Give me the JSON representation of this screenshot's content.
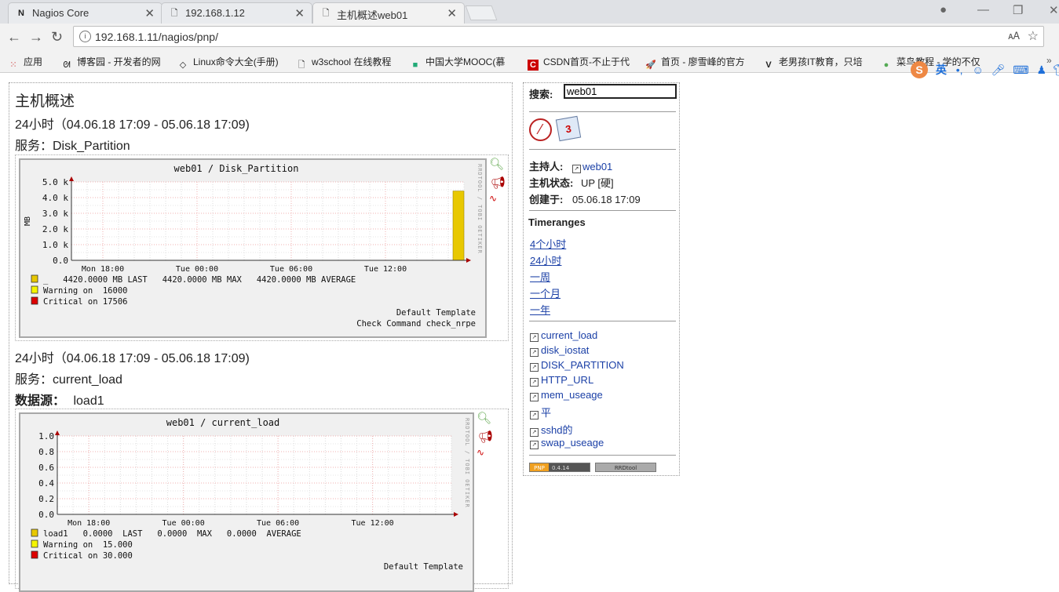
{
  "browser": {
    "tabs": [
      {
        "label": "Nagios Core",
        "icon": "nagios-favicon"
      },
      {
        "label": "192.168.1.12",
        "icon": "page-icon"
      },
      {
        "label": "主机概述web01",
        "icon": "page-icon"
      }
    ],
    "url": "192.168.1.11/nagios/pnp/",
    "bookmarks": [
      {
        "label": "应用",
        "icon": "apps-grid-icon"
      },
      {
        "label": "博客园 - 开发者的网",
        "icon": "cnblogs-icon"
      },
      {
        "label": "Linux命令大全(手册)",
        "icon": "linux-icon"
      },
      {
        "label": "w3school 在线教程",
        "icon": "page-icon"
      },
      {
        "label": "中国大学MOOC(慕",
        "icon": "mooc-icon"
      },
      {
        "label": "CSDN首页-不止于代",
        "icon": "csdn-icon"
      },
      {
        "label": "首页 - 廖雪峰的官方",
        "icon": "rocket-icon"
      },
      {
        "label": "老男孩IT教育，只培",
        "icon": "v-logo-icon"
      },
      {
        "label": "菜鸟教程 - 学的不仅",
        "icon": "runoob-icon"
      }
    ],
    "ime_label": "英"
  },
  "main": {
    "title": "主机概述",
    "sections": [
      {
        "range": "24小时（04.06.18 17:09 - 05.06.18 17:09)",
        "service": "服务：Disk_Partition",
        "datasource_label": "",
        "datasource_value": ""
      },
      {
        "range": "24小时（04.06.18 17:09 - 05.06.18 17:09)",
        "service": "服务：current_load",
        "datasource_label": "数据源：",
        "datasource_value": "load1"
      }
    ]
  },
  "chart_data": [
    {
      "type": "bar",
      "title": "web01 / Disk_Partition",
      "ylabel": "MB",
      "ylim": [
        0,
        5000
      ],
      "yticks": [
        "5.0 k",
        "4.0 k",
        "3.0 k",
        "2.0 k",
        "1.0 k",
        "0.0"
      ],
      "xticks": [
        "Mon 18:00",
        "Tue 00:00",
        "Tue 06:00",
        "Tue 12:00"
      ],
      "x_range_hours": [
        16,
        41
      ],
      "series": [
        {
          "name": "_",
          "x_hours": [
            40.3,
            41.0
          ],
          "value": 4420,
          "color": "#e8c800"
        }
      ],
      "watermark": "RRDTOOL / TOBI OETIKER",
      "legend": [
        {
          "color": "#e8c800",
          "text": "_   4420.0000 MB LAST   4420.0000 MB MAX   4420.0000 MB AVERAGE"
        },
        {
          "color": "#f5f500",
          "text": "Warning on  16000"
        },
        {
          "color": "#dd0000",
          "text": "Critical on 17506"
        }
      ],
      "footer": [
        "Default Template",
        "Check Command check_nrpe"
      ]
    },
    {
      "type": "line",
      "title": "web01 / current_load",
      "ylabel": "",
      "ylim": [
        0,
        1.0
      ],
      "yticks": [
        "1.0",
        "0.8",
        "0.6",
        "0.4",
        "0.2",
        "0.0"
      ],
      "xticks": [
        "Mon 18:00",
        "Tue 00:00",
        "Tue 06:00",
        "Tue 12:00"
      ],
      "x_range_hours": [
        16,
        41
      ],
      "series": [
        {
          "name": "load1",
          "values": []
        }
      ],
      "watermark": "RRDTOOL / TOBI OETIKER",
      "legend": [
        {
          "color": "#e8c800",
          "text": "load1   0.0000  LAST   0.0000  MAX   0.0000  AVERAGE"
        },
        {
          "color": "#f5f500",
          "text": "Warning on  15.000"
        },
        {
          "color": "#dd0000",
          "text": "Critical on 30.000"
        }
      ],
      "footer": [
        "Default Template"
      ]
    }
  ],
  "side": {
    "search_label": "搜索:",
    "search_value": "web01",
    "host_label": "主持人:",
    "host_value": "web01",
    "state_label": "主机状态:",
    "state_value": "UP [硬]",
    "created_label": "创建于:",
    "created_value": "05.06.18 17:09",
    "timeranges_title": "Timeranges",
    "timeranges": [
      "4个小时",
      "24小时",
      "一周",
      "一个月",
      "一年"
    ],
    "services": [
      "current_load",
      "disk_iostat",
      "DISK_PARTITION",
      "HTTP_URL",
      "mem_useage",
      "平",
      "sshd的",
      "swap_useage"
    ],
    "badge_pnp": "PNP",
    "badge_version": "0.4.14",
    "badge_rrd": "RRDtool"
  }
}
